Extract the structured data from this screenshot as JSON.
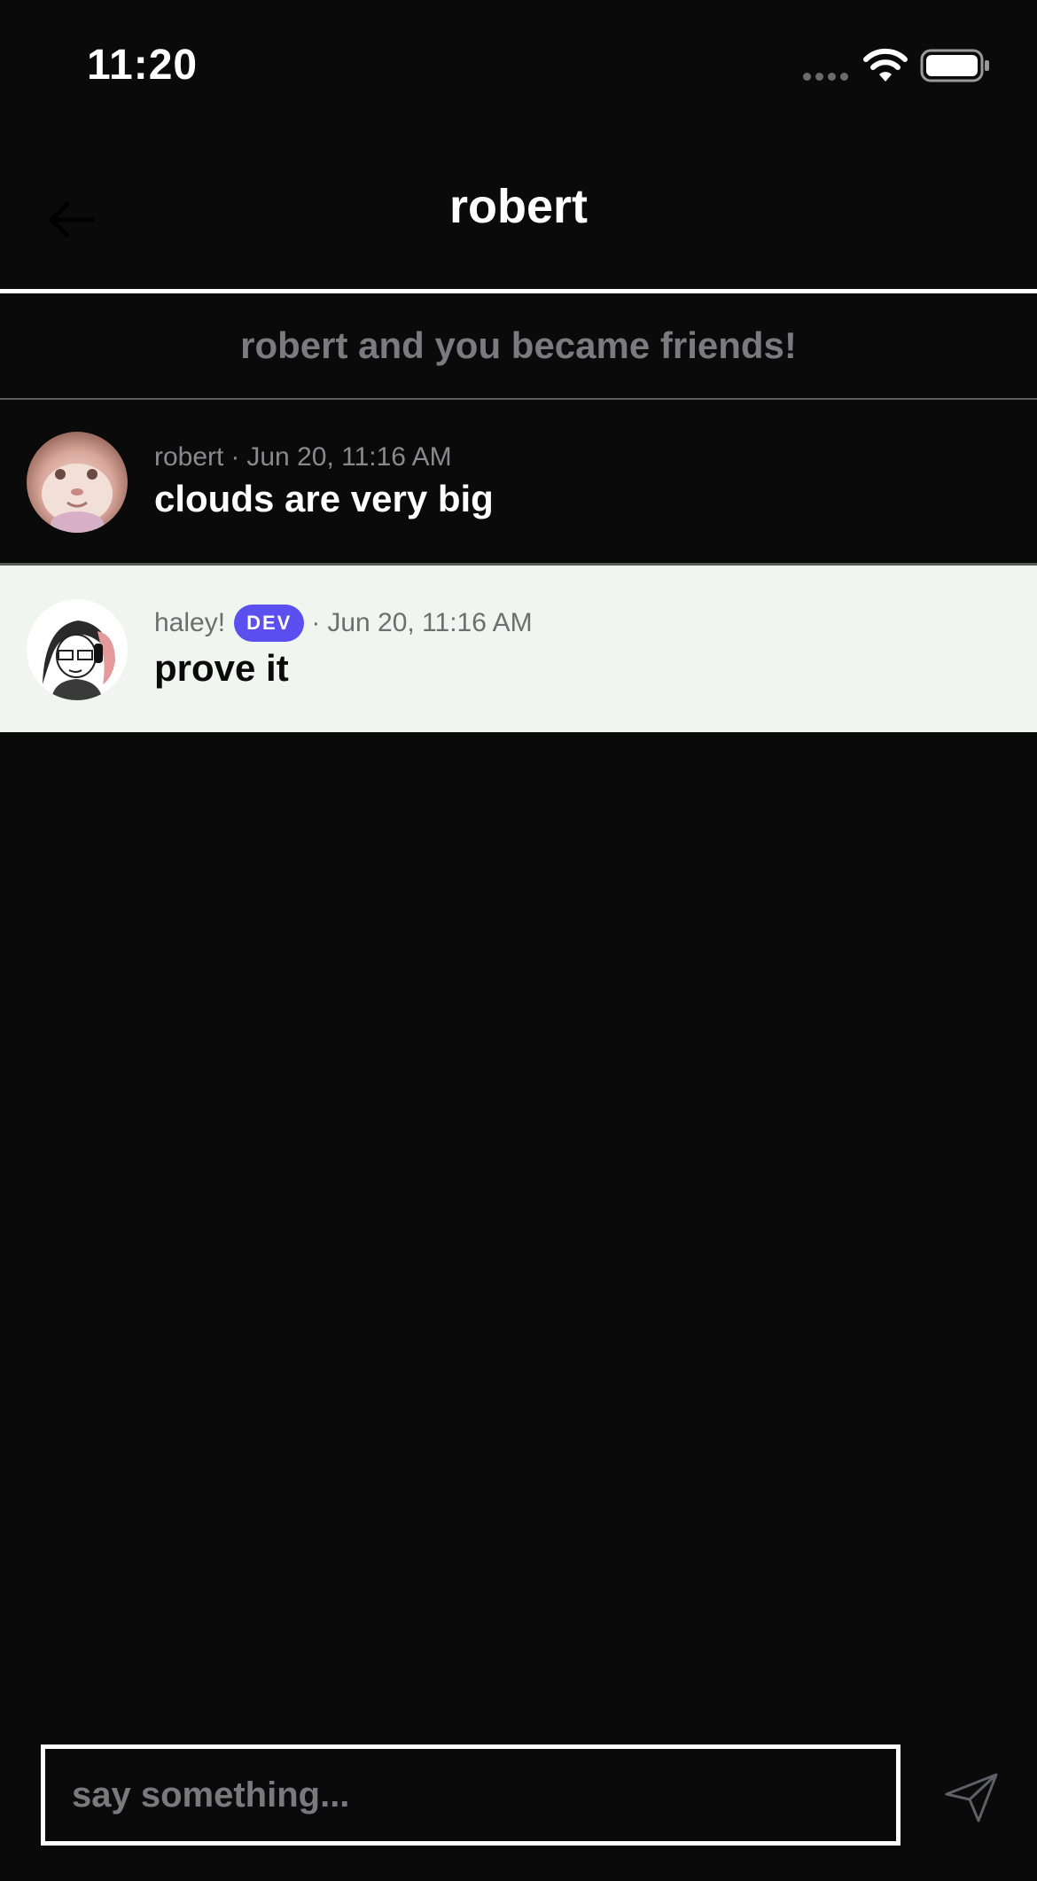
{
  "status_bar": {
    "time": "11:20",
    "icons": [
      "signal-dots-icon",
      "wifi-icon",
      "battery-icon"
    ]
  },
  "header": {
    "title": "robert",
    "back_icon": "arrow-left-icon"
  },
  "system_banner": {
    "text": "robert and you became friends!"
  },
  "messages": [
    {
      "author": "robert",
      "separator": "·",
      "timestamp": "Jun 20, 11:16 AM",
      "text": "clouds are very big",
      "avatar": "robert-avatar"
    },
    {
      "author": "haley!",
      "badge": "DEV",
      "separator": "·",
      "timestamp": "Jun 20, 11:16 AM",
      "text": "prove it",
      "avatar": "haley-avatar"
    }
  ],
  "composer": {
    "placeholder": "say something...",
    "send_icon": "send-icon"
  },
  "colors": {
    "background": "#0a0a0b",
    "highlight_row": "#f0f6ef",
    "badge": "#5b4ff0",
    "muted_text": "#7b7b7e"
  }
}
